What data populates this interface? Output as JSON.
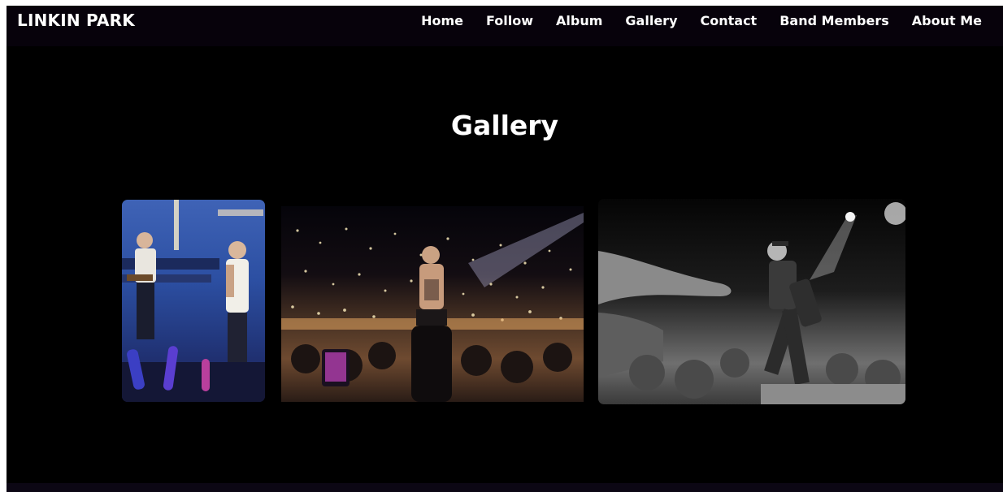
{
  "brand": "LINKIN PARK",
  "nav": {
    "items": [
      {
        "label": "Home"
      },
      {
        "label": "Follow"
      },
      {
        "label": "Album"
      },
      {
        "label": "Gallery"
      },
      {
        "label": "Contact"
      },
      {
        "label": "Band Members"
      },
      {
        "label": "About Me"
      }
    ]
  },
  "gallery": {
    "title": "Gallery"
  },
  "colors": {
    "page_background": "#000000",
    "navbar_background": "#07020b",
    "text": "#ffffff"
  }
}
